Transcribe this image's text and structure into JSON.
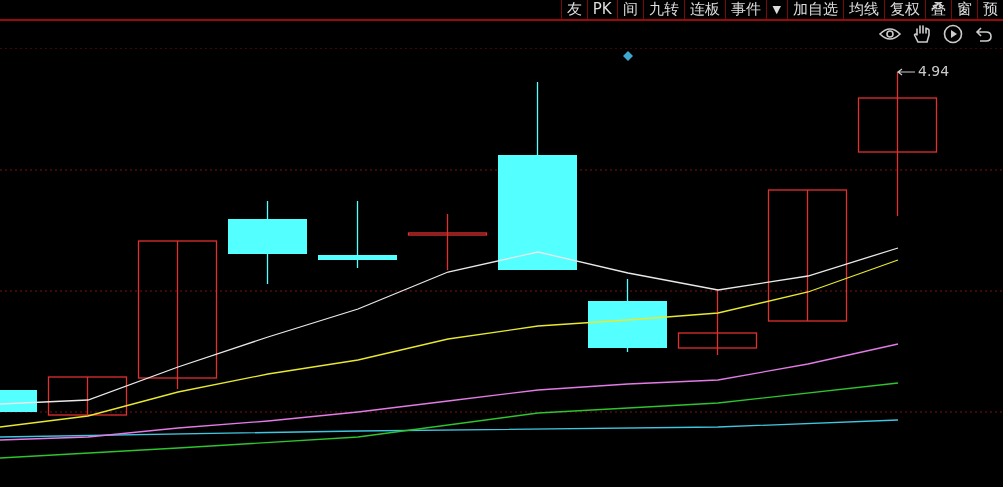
{
  "toolbar": [
    {
      "label": "友",
      "kind": "button"
    },
    {
      "label": "PK",
      "kind": "button"
    },
    {
      "label": "间",
      "kind": "button"
    },
    {
      "label": "九转",
      "kind": "button"
    },
    {
      "label": "连板",
      "kind": "button"
    },
    {
      "label": "事件",
      "kind": "button"
    },
    {
      "label": "▼",
      "kind": "dropdown"
    },
    {
      "label": "加自选",
      "kind": "button"
    },
    {
      "label": "均线",
      "kind": "button"
    },
    {
      "label": "复权",
      "kind": "button"
    },
    {
      "label": "叠",
      "kind": "button"
    },
    {
      "label": "窗",
      "kind": "button"
    },
    {
      "label": "预",
      "kind": "button"
    }
  ],
  "chart": {
    "high_label": "4.94"
  }
}
